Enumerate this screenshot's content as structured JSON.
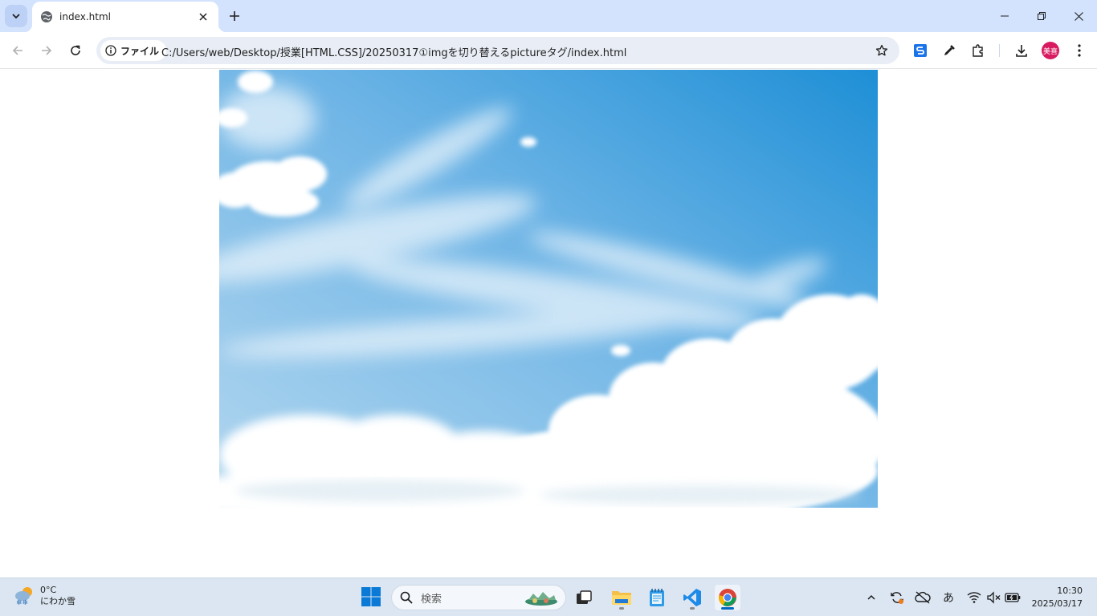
{
  "browser": {
    "tab": {
      "title": "index.html"
    },
    "address_bar": {
      "site_chip_label": "ファイル",
      "url": "C:/Users/web/Desktop/授業[HTML.CSS]/20250317①imgを切り替えるpictureタグ/index.html"
    },
    "profile": {
      "avatar_text": "美喜",
      "avatar_color": "#d81b60"
    }
  },
  "page": {
    "image": {
      "subject": "blue sky with white cumulus clouds"
    }
  },
  "taskbar": {
    "weather": {
      "temperature": "0°C",
      "condition": "にわか雪"
    },
    "search": {
      "placeholder": "検索"
    },
    "ime_indicator": "あ",
    "clock": {
      "time": "10:30",
      "date": "2025/03/17"
    }
  },
  "colors": {
    "tabstrip_bg": "#d3e3fd",
    "taskbar_bg": "#dbe6f2",
    "accent": "#0067c0"
  }
}
